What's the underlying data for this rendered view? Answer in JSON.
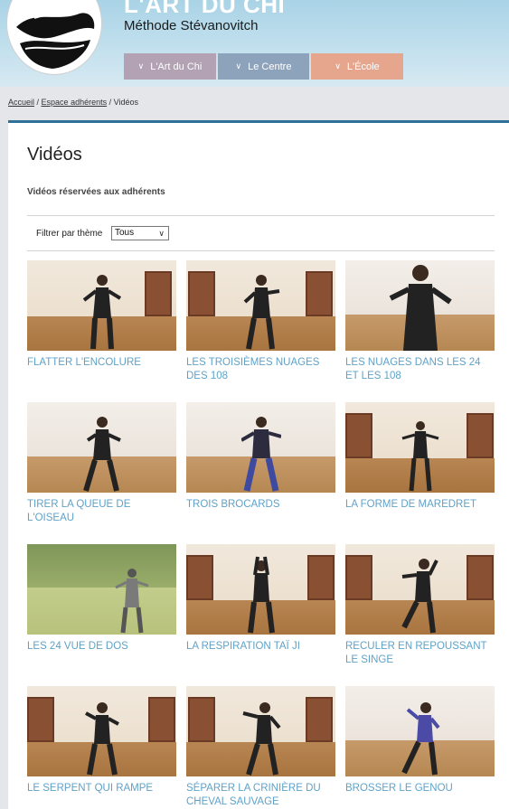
{
  "header": {
    "site_title": "L'ART DU CHI",
    "site_subtitle": "Méthode Stévanovitch",
    "nav": [
      {
        "label": "L'Art du Chi"
      },
      {
        "label": "Le Centre"
      },
      {
        "label": "L'École"
      }
    ]
  },
  "breadcrumb": {
    "home": "Accueil",
    "members": "Espace adhérents",
    "current": "Vidéos"
  },
  "page": {
    "title": "Vidéos",
    "subtitle": "Vidéos réservées aux adhérents",
    "filter_label": "Filtrer par thème",
    "filter_value": "Tous"
  },
  "videos": [
    {
      "title": "FLATTER L'ENCOLURE"
    },
    {
      "title": "LES TROISIÈMES NUAGES DES 108"
    },
    {
      "title": "LES NUAGES DANS LES 24 ET LES 108"
    },
    {
      "title": "TIRER LA QUEUE DE L'OISEAU"
    },
    {
      "title": "TROIS BROCARDS"
    },
    {
      "title": "LA FORME DE MAREDRET"
    },
    {
      "title": "LES 24 VUE DE DOS"
    },
    {
      "title": "LA RESPIRATION TAÏ JI"
    },
    {
      "title": "RECULER EN REPOUSSANT LE SINGE"
    },
    {
      "title": "LE SERPENT QUI RAMPE"
    },
    {
      "title": "SÉPARER LA CRINIÈRE DU CHEVAL SAUVAGE"
    },
    {
      "title": "BROSSER LE GENOU"
    }
  ],
  "colors": {
    "accent_bar": "#2d7196",
    "link": "#5fa2c8",
    "nav_1": "#b2a2b4",
    "nav_2": "#8da3bb",
    "nav_3": "#e6a58d"
  }
}
